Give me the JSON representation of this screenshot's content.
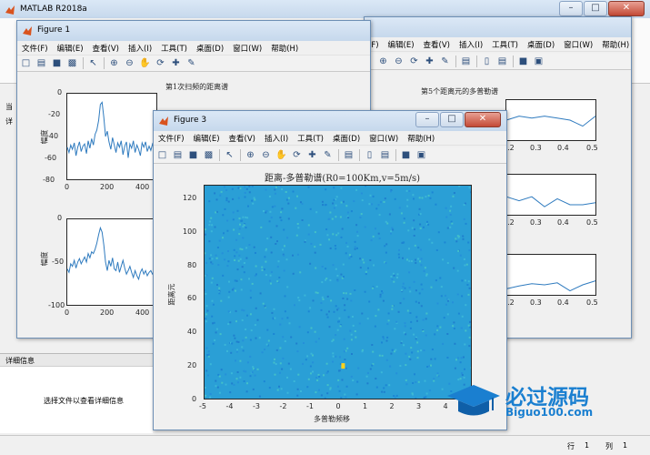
{
  "matlab": {
    "title": "MATLAB R2018a",
    "left_glyphs": [
      "当",
      "详"
    ],
    "details_label": "详细信息",
    "select_hint": "选择文件以查看详细信息",
    "status_row_label": "行",
    "status_row": "1",
    "status_col_label": "列",
    "status_col": "1"
  },
  "menu_labels": [
    "文件(F)",
    "编辑(E)",
    "查看(V)",
    "插入(I)",
    "工具(T)",
    "桌面(D)",
    "窗口(W)",
    "帮助(H)"
  ],
  "figure1": {
    "title": "Figure 1",
    "top_plot": {
      "title": "第1次扫频的距离谱",
      "ylabel": "幅度",
      "yticks": [
        "0",
        "-20",
        "-40",
        "-60",
        "-80"
      ],
      "xticks": [
        "0",
        "200",
        "400"
      ]
    },
    "bottom_plot": {
      "ylabel": "幅度",
      "yticks": [
        "0",
        "-50",
        "-100"
      ],
      "xticks": [
        "0",
        "200",
        "400"
      ]
    }
  },
  "figure2": {
    "plot1": {
      "title": "第5个距离元的多普勒谱"
    },
    "xticks": [
      "0.2",
      "0.3",
      "0.4",
      "0.5"
    ]
  },
  "figure3": {
    "title": "Figure 3"
  },
  "chart_data": [
    {
      "type": "line",
      "title": "第1次扫频的距离谱",
      "xlabel": "",
      "ylabel": "幅度",
      "xlim": [
        0,
        512
      ],
      "ylim": [
        -80,
        0
      ],
      "x": [
        0,
        10,
        20,
        30,
        40,
        50,
        60,
        70,
        80,
        90,
        100,
        110,
        120,
        130,
        140,
        150,
        160,
        170,
        180,
        190,
        200,
        210,
        220,
        230,
        240,
        250,
        260,
        270,
        280,
        290,
        300,
        310,
        320,
        330,
        340,
        350,
        360,
        370,
        380,
        390,
        400,
        410,
        420,
        430,
        440,
        450,
        460,
        470,
        480,
        490,
        500,
        510
      ],
      "y": [
        -50,
        -55,
        -48,
        -52,
        -46,
        -58,
        -50,
        -45,
        -54,
        -49,
        -47,
        -56,
        -44,
        -51,
        -42,
        -48,
        -38,
        -34,
        -25,
        -10,
        -8,
        -22,
        -40,
        -35,
        -45,
        -52,
        -41,
        -48,
        -55,
        -46,
        -50,
        -44,
        -57,
        -49,
        -45,
        -60,
        -47,
        -51,
        -44,
        -55,
        -48,
        -52,
        -58,
        -46,
        -50,
        -45,
        -54,
        -49,
        -53,
        -47,
        -51,
        -50
      ]
    },
    {
      "type": "line",
      "title": "",
      "xlabel": "",
      "ylabel": "幅度",
      "xlim": [
        0,
        512
      ],
      "ylim": [
        -100,
        0
      ],
      "x": [
        0,
        10,
        20,
        30,
        40,
        50,
        60,
        70,
        80,
        90,
        100,
        110,
        120,
        130,
        140,
        150,
        160,
        170,
        180,
        190,
        200,
        210,
        220,
        230,
        240,
        250,
        260,
        270,
        280,
        290,
        300,
        310,
        320,
        330,
        340,
        350,
        360,
        370,
        380,
        390,
        400,
        410,
        420,
        430,
        440,
        450,
        460,
        470,
        480,
        490,
        500,
        510
      ],
      "y": [
        -58,
        -62,
        -52,
        -55,
        -48,
        -57,
        -50,
        -46,
        -52,
        -48,
        -44,
        -50,
        -40,
        -45,
        -38,
        -40,
        -35,
        -28,
        -18,
        -10,
        -15,
        -30,
        -50,
        -60,
        -48,
        -55,
        -45,
        -58,
        -60,
        -50,
        -62,
        -55,
        -48,
        -57,
        -64,
        -60,
        -55,
        -62,
        -68,
        -60,
        -66,
        -70,
        -62,
        -58,
        -64,
        -60,
        -66,
        -62,
        -60,
        -64,
        -61,
        -62
      ]
    },
    {
      "type": "line",
      "title": "第5个距离元的多普勒谱",
      "xlabel": "",
      "ylabel": "",
      "xlim": [
        0.15,
        0.5
      ],
      "ylim": [
        0,
        1
      ],
      "x": [
        0.15,
        0.2,
        0.25,
        0.3,
        0.35,
        0.4,
        0.45,
        0.5
      ],
      "y": [
        0.5,
        0.6,
        0.55,
        0.6,
        0.55,
        0.5,
        0.35,
        0.6
      ]
    },
    {
      "type": "line",
      "title": "",
      "xlabel": "",
      "ylabel": "",
      "xlim": [
        0.15,
        0.5
      ],
      "ylim": [
        0,
        1
      ],
      "x": [
        0.15,
        0.2,
        0.25,
        0.3,
        0.35,
        0.4,
        0.45,
        0.5
      ],
      "y": [
        0.45,
        0.35,
        0.45,
        0.2,
        0.4,
        0.25,
        0.25,
        0.3
      ]
    },
    {
      "type": "line",
      "title": "",
      "xlabel": "",
      "ylabel": "",
      "xlim": [
        0.15,
        0.5
      ],
      "ylim": [
        0,
        1
      ],
      "x": [
        0.15,
        0.2,
        0.25,
        0.3,
        0.35,
        0.4,
        0.45,
        0.5
      ],
      "y": [
        0.15,
        0.22,
        0.28,
        0.25,
        0.3,
        0.1,
        0.25,
        0.35
      ]
    },
    {
      "type": "heatmap",
      "title": "距离-多普勒谱(R0=100Km,v=5m/s)",
      "xlabel": "多普勒频移",
      "ylabel": "距离元",
      "xlim": [
        -5,
        5
      ],
      "ylim": [
        0,
        128
      ],
      "xticks": [
        -5,
        -4,
        -3,
        -2,
        -1,
        0,
        1,
        2,
        3,
        4
      ],
      "yticks": [
        0,
        20,
        40,
        60,
        80,
        100,
        120
      ],
      "background_color": "#2a9fd6",
      "peak": {
        "x": 0.2,
        "y": 20,
        "color": "#ffd21a"
      }
    }
  ],
  "watermark": {
    "brand_cn": "必过源码",
    "brand_url": "Biguo100.com"
  }
}
